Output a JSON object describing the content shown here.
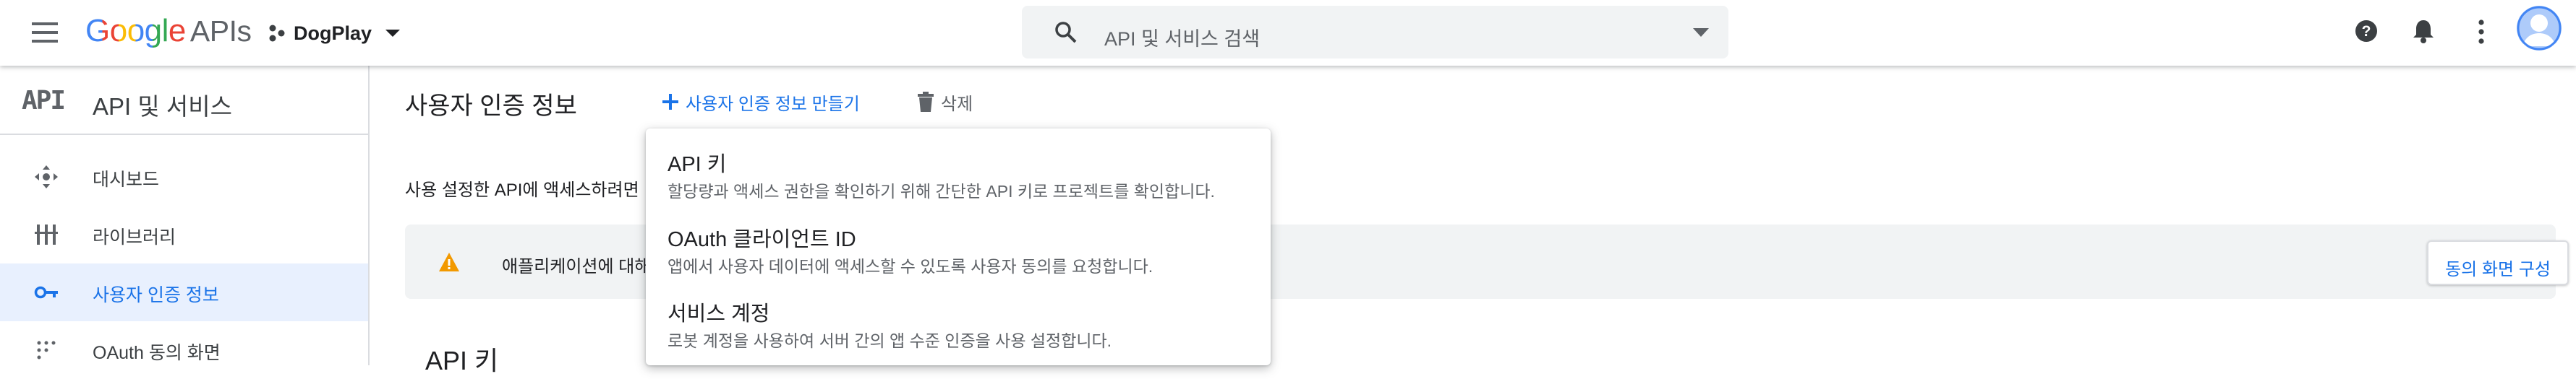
{
  "topbar": {
    "logo_google": "Google",
    "logo_apis": "APIs",
    "project_name": "DogPlay",
    "search_placeholder": "API 및 서비스 검색"
  },
  "sidebar": {
    "title": "API 및 서비스",
    "api_mark": "API",
    "items": [
      {
        "label": "대시보드",
        "icon": "dashboard-icon"
      },
      {
        "label": "라이브러리",
        "icon": "library-icon"
      },
      {
        "label": "사용자 인증 정보",
        "icon": "key-icon",
        "active": true
      },
      {
        "label": "OAuth 동의 화면",
        "icon": "consent-icon"
      }
    ]
  },
  "main": {
    "page_title": "사용자 인증 정보",
    "create_label": "사용자 인증 정보 만들기",
    "delete_label": "삭제",
    "description": "사용 설정한 API에 액세스하려면",
    "notice_text": "애플리케이션에 대해",
    "consent_button": "동의 화면 구성",
    "apikey_heading": "API 키"
  },
  "dropdown": {
    "items": [
      {
        "title": "API 키",
        "subtitle": "할당량과 액세스 권한을 확인하기 위해 간단한 API 키로 프로젝트를 확인합니다."
      },
      {
        "title": "OAuth 클라이언트 ID",
        "subtitle": "앱에서 사용자 데이터에 액세스할 수 있도록 사용자 동의를 요청합니다."
      },
      {
        "title": "서비스 계정",
        "subtitle": "로봇 계정을 사용하여 서버 간의 앱 수준 인증을 사용 설정합니다."
      }
    ]
  },
  "colors": {
    "accent": "#1a73e8",
    "warning": "#f29900",
    "active_bg": "#e8f0fe"
  }
}
